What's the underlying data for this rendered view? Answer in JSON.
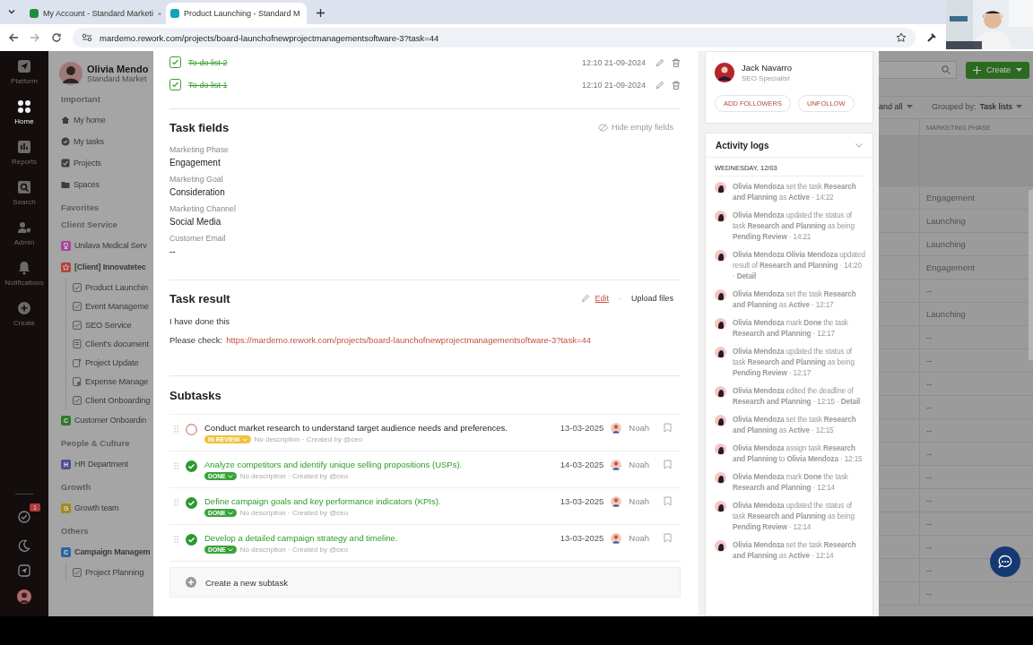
{
  "browser": {
    "tabs": [
      {
        "title": "My Account - Standard Marketi",
        "selected": false,
        "color": "#1e8e3e"
      },
      {
        "title": "Product Launching - Standard M",
        "selected": true,
        "color": "#12a4b5"
      }
    ],
    "url": "mardemo.rework.com/projects/board-launchofnewprojectmanagementsoftware-3?task=44"
  },
  "nav_rail": {
    "items": [
      {
        "label": "Platform",
        "kind": "platform",
        "selected": false
      },
      {
        "label": "Home",
        "kind": "home",
        "selected": true
      },
      {
        "label": "Reports",
        "kind": "reports",
        "selected": false
      },
      {
        "label": "Search",
        "kind": "search",
        "selected": false
      },
      {
        "label": "Admin",
        "kind": "admin",
        "selected": false
      },
      {
        "label": "Notifications",
        "kind": "bell",
        "selected": false
      },
      {
        "label": "Create",
        "kind": "create",
        "selected": false
      }
    ],
    "badge": "1"
  },
  "sidebar": {
    "user": {
      "name": "Olivia Mendo",
      "role": "Standard Market"
    },
    "sections": [
      {
        "title": "Important",
        "items": [
          {
            "label": "My home",
            "kind": "home"
          },
          {
            "label": "My tasks",
            "kind": "check"
          },
          {
            "label": "Projects",
            "kind": "checkbox"
          },
          {
            "label": "Spaces",
            "kind": "folder"
          }
        ]
      },
      {
        "title": "Favorites"
      },
      {
        "title": "Client Service",
        "items": [
          {
            "label": "Unilava Medical Serv",
            "kind": "trophy",
            "color": "#a8459a"
          },
          {
            "label": "[Client] Innovatetec",
            "kind": "star",
            "color": "#b3433b",
            "expanded": true,
            "children": [
              {
                "label": "Product Launchin",
                "kind": "task"
              },
              {
                "label": "Event Manageme",
                "kind": "task"
              },
              {
                "label": "SEO Service",
                "kind": "task"
              },
              {
                "label": "Client's document",
                "kind": "doc"
              },
              {
                "label": "Project Update",
                "kind": "update"
              },
              {
                "label": "Expense Manage",
                "kind": "expense"
              },
              {
                "label": "Client Onboarding",
                "kind": "task"
              }
            ]
          },
          {
            "label": "Customer Onboardin",
            "kind": "letter",
            "letter": "C",
            "color": "#2e7a2a"
          }
        ]
      },
      {
        "title": "People & Culture",
        "items": [
          {
            "label": "HR Department",
            "kind": "letter",
            "letter": "H",
            "color": "#4c5196"
          }
        ]
      },
      {
        "title": "Growth",
        "items": [
          {
            "label": "Growth team",
            "kind": "letter",
            "letter": "G",
            "color": "#a58a1e"
          }
        ]
      },
      {
        "title": "Others",
        "items": [
          {
            "label": "Campaign Managem",
            "kind": "letter",
            "letter": "C",
            "color": "#2b669e",
            "expanded": true,
            "children": [
              {
                "label": "Project Planning",
                "kind": "task"
              }
            ]
          }
        ]
      }
    ]
  },
  "todos": [
    {
      "title": "To-do list 2",
      "checked": true,
      "time": "12:10 21-09-2024"
    },
    {
      "title": "To-do list 1",
      "checked": true,
      "time": "12:10 21-09-2024"
    }
  ],
  "task_fields": {
    "title": "Task fields",
    "hide_empty": "Hide empty fields",
    "fields": [
      {
        "label": "Marketing Phase",
        "value": "Engagement"
      },
      {
        "label": "Marketing Goal",
        "value": "Consideration"
      },
      {
        "label": "Marketing Channel",
        "value": "Social Media"
      },
      {
        "label": "Customer Email",
        "value": "--"
      }
    ]
  },
  "task_result": {
    "title": "Task result",
    "edit": "Edit",
    "separator": "·",
    "upload": "Upload files",
    "text": "I have done this",
    "check_label": "Please check:",
    "link": "https://mardemo.rework.com/projects/board-launchofnewprojectmanagementsoftware-3?task=44"
  },
  "subtasks": {
    "title": "Subtasks",
    "items": [
      {
        "title": "Conduct market research to understand target audience needs and preferences.",
        "kind": "review",
        "status_label": "IN REVIEW",
        "meta": "No description · Created by @ceo",
        "date": "13-03-2025",
        "assignee": "Noah"
      },
      {
        "title": "Analyze competitors and identify unique selling propositions (USPs).",
        "kind": "done",
        "status_label": "DONE",
        "meta": "No description · Created by @ceo",
        "date": "14-03-2025",
        "assignee": "Noah"
      },
      {
        "title": "Define campaign goals and key performance indicators (KPIs).",
        "kind": "done",
        "status_label": "DONE",
        "meta": "No description · Created by @ceo",
        "date": "13-03-2025",
        "assignee": "Noah"
      },
      {
        "title": "Develop a detailed campaign strategy and timeline.",
        "kind": "done",
        "status_label": "DONE",
        "meta": "No description · Created by @ceo",
        "date": "13-03-2025",
        "assignee": "Noah"
      }
    ],
    "create": "Create a new subtask"
  },
  "follower": {
    "name": "Jack Navarro",
    "role": "SEO Specialist",
    "buttons": [
      "ADD FOLLOWERS",
      "UNFOLLOW"
    ]
  },
  "activity": {
    "title": "Activity logs",
    "date": "WEDNESDAY, 12/03",
    "entries": [
      "**Olivia Mendoza** set the task **Research and Planning** as **Active** · 14:22",
      "**Olivia Mendoza** updated the status of task **Research and Planning** as being **Pending Review** · 14:21",
      "**Olivia Mendoza Olivia Mendoza** updated result of **Research and Planning** · 14:20 · **Detail**",
      "**Olivia Mendoza** set the task **Research and Planning** as **Active** · 12:17",
      "**Olivia Mendoza** mark **Done** the task **Research and Planning** · 12:17",
      "**Olivia Mendoza** updated the status of task **Research and Planning** as being **Pending Review** · 12:17",
      "**Olivia Mendoza** edited the deadline of **Research and Planning** · 12:15 · **Detail**",
      "**Olivia Mendoza** set the task **Research and Planning** as **Active** · 12:15",
      "**Olivia Mendoza** assign task **Research and Planning** to **Olivia Mendoza** · 12:15",
      "**Olivia Mendoza** mark **Done** the task **Research and Planning** · 12:14",
      "**Olivia Mendoza** updated the status of task **Research and Planning** as being **Pending Review** · 12:14",
      "**Olivia Mendoza** set the task **Research and Planning** as **Active** · 12:14"
    ]
  },
  "background_board": {
    "create": "Create",
    "expand": "and all",
    "grouped_label": "Grouped by:",
    "grouped_value": "Task lists",
    "column": "MARKETING PHASE",
    "rows": [
      "Engagement",
      "Launching",
      "Launching",
      "Engagement",
      "--",
      "Launching",
      "--",
      "--",
      "--",
      "--",
      "--",
      "--",
      "--",
      "--",
      "--",
      "--",
      "--",
      "--"
    ]
  }
}
